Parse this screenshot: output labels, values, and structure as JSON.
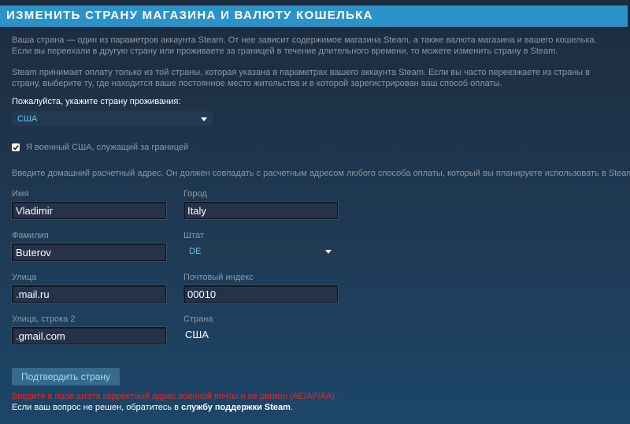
{
  "header": {
    "title": "ИЗМЕНИТЬ СТРАНУ МАГАЗИНА И ВАЛЮТУ КОШЕЛЬКА"
  },
  "intro": {
    "paragraph1": "Ваша страна — один из параметров аккаунта Steam. От нее зависит содержимое магазина Steam, а также валюта магазина и вашего кошелька. Если вы переехали в другую страну или проживаете за границей в течение длительного времени, то можете изменить страну в Steam.",
    "paragraph2": "Steam принимает оплату только из той страны, которая указана в параметрах вашего аккаунта Steam. Если вы часто переезжаете из страны в страну, выберите ту, где находится ваше постоянное место жительства и в которой зарегистрирован ваш способ оплаты."
  },
  "residence": {
    "label": "Пожалуйста, укажите страну проживания:",
    "selected": "США"
  },
  "military": {
    "label": "Я военный США, служащий за границей",
    "checked": true
  },
  "address_hint": "Введите домашний расчетный адрес. Он должен совпадать с расчетным адресом любого способа оплаты, который вы планируете использовать в Steam.",
  "form": {
    "first_name": {
      "label": "Имя",
      "value": "Vladimir"
    },
    "last_name": {
      "label": "Фамилия",
      "value": "Buterov"
    },
    "street": {
      "label": "Улица",
      "value": ".mail.ru"
    },
    "street2": {
      "label": "Улица, строка 2",
      "value": ".gmail.com"
    },
    "city": {
      "label": "Город",
      "value": "Italy"
    },
    "state": {
      "label": "Штат",
      "selected": "DE"
    },
    "postal": {
      "label": "Почтовый индекс",
      "value": "00010"
    },
    "country": {
      "label": "Страна",
      "value": "США"
    }
  },
  "submit_label": "Подтвердить страну",
  "error_text": "Введите в поле штата корректный адрес военной почты и ее регион (AE/AP/AA).",
  "support": {
    "prefix": "Если ваш вопрос не решен, обратитесь в ",
    "link": "службу поддержки Steam",
    "suffix": "."
  },
  "colors": {
    "header_bg": "#2c93c9",
    "link_blue": "#67c1f5",
    "error_red": "#e02a2a",
    "button_bg": "#386a8c"
  }
}
